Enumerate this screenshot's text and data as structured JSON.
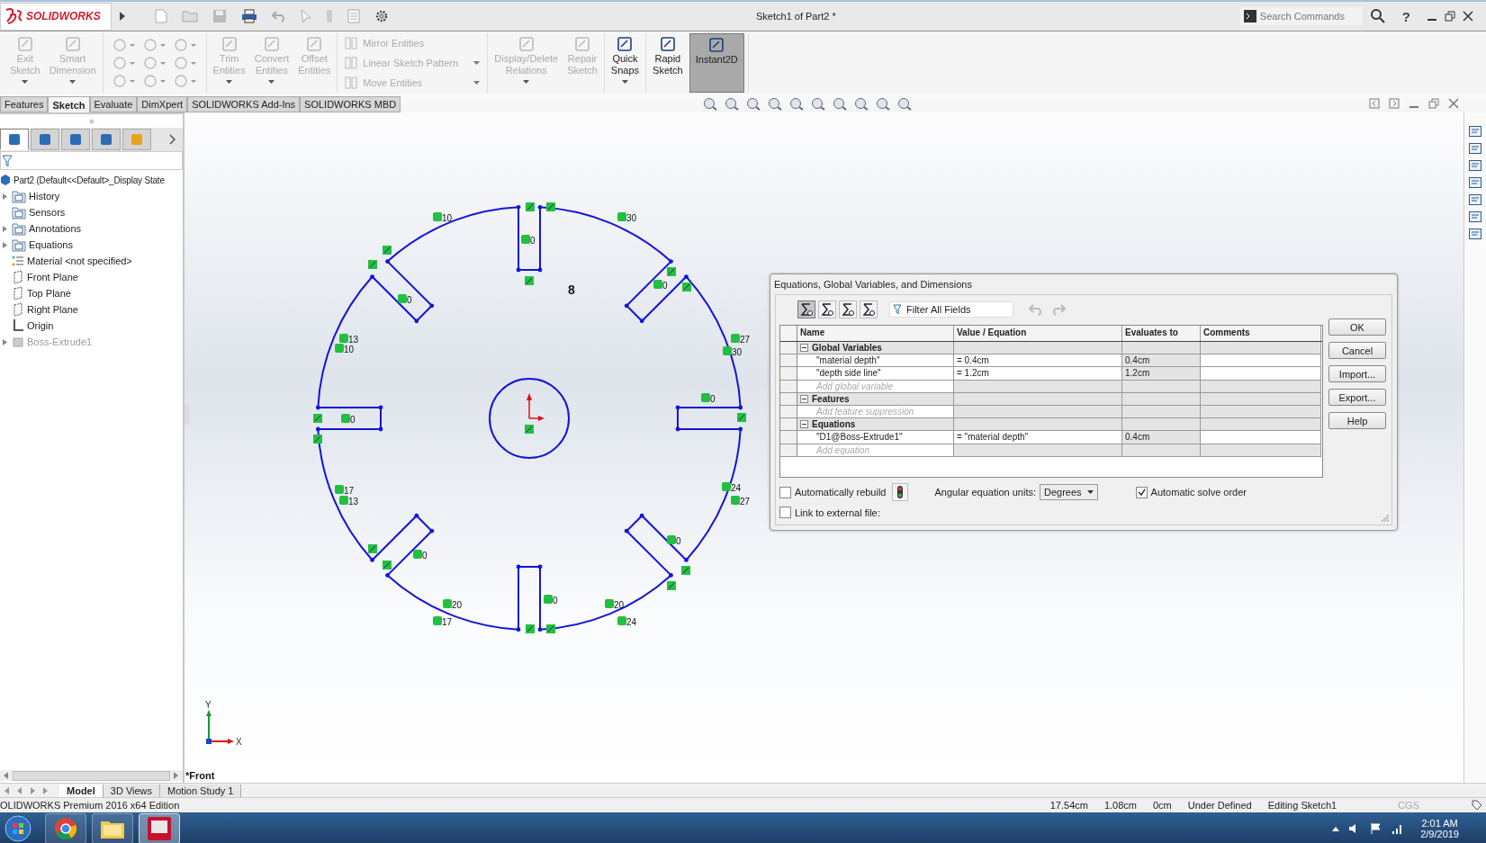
{
  "title_bar": {
    "logo": "SOLIDWORKS",
    "document_title": "Sketch1 of Part2 *",
    "search": {
      "placeholder": "Search Commands"
    },
    "help": "?"
  },
  "command_manager": {
    "groups": [
      {
        "kind": "large",
        "tools": [
          {
            "lines": [
              "Exit",
              "Sketch"
            ],
            "disabled": true,
            "dropdown": true,
            "selected": false
          },
          {
            "lines": [
              "Smart",
              "Dimension"
            ],
            "disabled": true,
            "dropdown": true,
            "selected": false
          }
        ]
      },
      {
        "kind": "icon_grid"
      },
      {
        "kind": "large",
        "tools": [
          {
            "lines": [
              "Trim",
              "Entities"
            ],
            "disabled": true,
            "dropdown": true,
            "selected": false
          },
          {
            "lines": [
              "Convert",
              "Entities"
            ],
            "disabled": true,
            "dropdown": true,
            "selected": false
          },
          {
            "lines": [
              "Offset",
              "Entities"
            ],
            "disabled": true,
            "dropdown": false,
            "selected": false
          }
        ]
      },
      {
        "kind": "list",
        "tools": [
          {
            "label": "Mirror Entities",
            "disabled": true,
            "dropdown": false
          },
          {
            "label": "Linear Sketch Pattern",
            "disabled": true,
            "dropdown": true
          },
          {
            "label": "Move Entities",
            "disabled": true,
            "dropdown": true
          }
        ]
      },
      {
        "kind": "large",
        "tools": [
          {
            "lines": [
              "Display/Delete",
              "Relations"
            ],
            "disabled": true,
            "dropdown": true,
            "selected": false
          },
          {
            "lines": [
              "Repair",
              "Sketch"
            ],
            "disabled": true,
            "dropdown": false,
            "selected": false
          }
        ]
      },
      {
        "kind": "large",
        "tools": [
          {
            "lines": [
              "Quick",
              "Snaps"
            ],
            "disabled": false,
            "dropdown": true,
            "selected": false
          }
        ]
      },
      {
        "kind": "large",
        "tools": [
          {
            "lines": [
              "Rapid",
              "Sketch"
            ],
            "disabled": false,
            "dropdown": false,
            "selected": false
          },
          {
            "lines": [
              "Instant2D"
            ],
            "disabled": false,
            "dropdown": false,
            "selected": true
          }
        ]
      }
    ]
  },
  "tabs": [
    {
      "label": "Features",
      "selected": false
    },
    {
      "label": "Sketch",
      "selected": true
    },
    {
      "label": "Evaluate",
      "selected": false
    },
    {
      "label": "DimXpert",
      "selected": false
    },
    {
      "label": "SOLIDWORKS Add-Ins",
      "selected": false
    },
    {
      "label": "SOLIDWORKS MBD",
      "selected": false
    }
  ],
  "feature_tree": {
    "panel_tabs": [
      {
        "selected": true
      },
      {
        "selected": false
      },
      {
        "selected": false
      },
      {
        "selected": false
      },
      {
        "selected": false
      }
    ],
    "root": {
      "label": "Part2  (Default<<Default>_Display State",
      "children": [
        {
          "label": "History",
          "kind": "history",
          "expandable": true,
          "disabled": false
        },
        {
          "label": "Sensors",
          "kind": "sensors",
          "expandable": false,
          "disabled": false
        },
        {
          "label": "Annotations",
          "kind": "annotations",
          "expandable": true,
          "disabled": false
        },
        {
          "label": "Equations",
          "kind": "equations",
          "expandable": true,
          "disabled": false
        },
        {
          "label": "Material <not specified>",
          "kind": "material",
          "expandable": false,
          "disabled": false
        },
        {
          "label": "Front Plane",
          "kind": "plane",
          "expandable": false,
          "disabled": false
        },
        {
          "label": "Top Plane",
          "kind": "plane",
          "expandable": false,
          "disabled": false
        },
        {
          "label": "Right Plane",
          "kind": "plane",
          "expandable": false,
          "disabled": false
        },
        {
          "label": "Origin",
          "kind": "origin",
          "expandable": false,
          "disabled": false
        },
        {
          "label": "Boss-Extrude1",
          "kind": "feature",
          "expandable": true,
          "disabled": true
        }
      ]
    }
  },
  "graphics_area": {
    "view_name": "*Front",
    "dimension": "8",
    "relation_labels": [
      "10",
      "30",
      "0",
      "0",
      "0",
      "13",
      "10",
      "27",
      "30",
      "0",
      "0",
      "17",
      "13",
      "24",
      "27",
      "0",
      "0",
      "20",
      "0",
      "20",
      "17",
      "24"
    ],
    "triad": {
      "x": "X",
      "y": "Y"
    }
  },
  "dialog": {
    "title": "Equations, Global Variables, and Dimensions",
    "view_buttons": [
      {
        "selected": true
      },
      {
        "selected": false
      },
      {
        "selected": false
      },
      {
        "selected": false
      }
    ],
    "filter": {
      "placeholder": "Filter All Fields"
    },
    "columns": [
      "Name",
      "Value / Equation",
      "Evaluates to",
      "Comments"
    ],
    "rows": [
      {
        "kind": "section",
        "label": "Global Variables",
        "expanded": true
      },
      {
        "kind": "item",
        "name": "\"material depth\"",
        "value": "= 0.4cm",
        "result": "0.4cm"
      },
      {
        "kind": "item",
        "name": "\"depth side line\"",
        "value": "= 1.2cm",
        "result": "1.2cm"
      },
      {
        "kind": "add",
        "hint": "Add global variable"
      },
      {
        "kind": "section",
        "label": "Features",
        "expanded": true
      },
      {
        "kind": "add",
        "hint": "Add feature suppression"
      },
      {
        "kind": "section",
        "label": "Equations",
        "expanded": true
      },
      {
        "kind": "item",
        "name": "\"D1@Boss-Extrude1\"",
        "value": "= \"material depth\"",
        "result": "0.4cm"
      },
      {
        "kind": "add",
        "hint": "Add equation"
      }
    ],
    "buttons": [
      "OK",
      "Cancel",
      "Import...",
      "Export...",
      "Help"
    ],
    "options": {
      "auto_rebuild": {
        "label": "Automatically rebuild",
        "checked": false
      },
      "link_external": {
        "label": "Link to external file:",
        "checked": false
      },
      "angular_units": {
        "label": "Angular equation units:",
        "value": "Degrees"
      },
      "solve_order": {
        "label": "Automatic solve order",
        "checked": true
      }
    }
  },
  "bottom_tabs": [
    {
      "label": "Model",
      "selected": true
    },
    {
      "label": "3D Views",
      "selected": false
    },
    {
      "label": "Motion Study 1",
      "selected": false
    }
  ],
  "status_bar": {
    "edition": "OLIDWORKS Premium 2016 x64 Edition",
    "readings": [
      "17.54cm",
      "1.08cm",
      "0cm",
      "Under Defined",
      "Editing Sketch1"
    ],
    "units": "CGS"
  },
  "taskbar": {
    "apps": [
      {
        "kind": "chrome",
        "selected": false
      },
      {
        "kind": "explorer",
        "selected": false
      },
      {
        "kind": "solidworks",
        "selected": true
      }
    ],
    "time": "2:01 AM",
    "date": "2/9/2019"
  }
}
